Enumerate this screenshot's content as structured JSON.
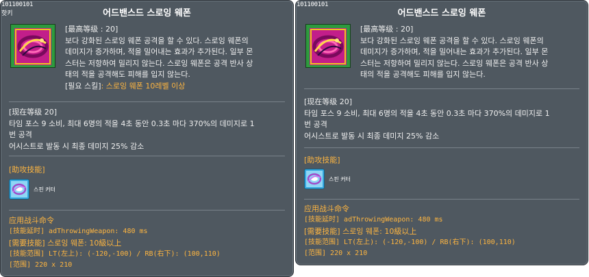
{
  "tooltips": [
    {
      "skill_id": "101100101",
      "hotkey": "핫키",
      "title": "어드밴스드 스로잉 웨폰",
      "icon": "throwing-weapon-skill-icon",
      "desc_lines": [
        "[最高等级 : 20]",
        "보다 강화된 스로잉 웨폰 공격을 할 수 있다. 스로잉 웨폰의",
        "데미지가 증가하며, 적을 밀어내는 효과가 추가된다. 일부 몬",
        "스터는 저항하여 밀리지 않는다. 스로잉 웨폰은 공격 반사 상",
        "태의 적을 공격해도 피해를 입지 않는다."
      ],
      "required_skill_label": "[필요 스킬]",
      "required_skill_value": ": 스로잉 웨폰 10레벨 이상",
      "current_level_lines": [
        "[现在等级 20]",
        "타임 포스 9 소비, 최대 6명의 적을 4초 동안 0.3초 마다 370%의 데미지로 1",
        "번 공격",
        "어시스트로 발동 시 최종 데미지 25% 감소"
      ],
      "assist_title": "[助攻技能]",
      "assist_skill_name": "스핀 커터",
      "assist_icon": "spin-cutter-skill-icon",
      "combat_lines": [
        "应用战斗命令",
        "[技能延时] adThrowingWeapon: 480 ms",
        "[需要技能] 스로잉 웨폰: 10級以上",
        "[技能范围] LT(左上): (-120,-100) / RB(右下): (100,110)",
        "[范围] 220 x 210"
      ]
    },
    {
      "skill_id": "101100101",
      "title": "어드밴스드 스로잉 웨폰",
      "icon": "throwing-weapon-skill-icon",
      "desc_lines": [
        "[最高等级 : 20]",
        "보다 강화된 스로잉 웨폰 공격을 할 수 있다. 스로잉 웨폰의",
        "데미지가 증가하며, 적을 밀어내는 효과가 추가된다. 일부 몬",
        "스터는 저항하여 밀리지 않는다. 스로잉 웨폰은 공격 반사 상",
        "태의 적을 공격해도 피해를 입지 않는다."
      ],
      "current_level_lines": [
        "[现在等级 20]",
        "타임 포스 9 소비, 최대 6명의 적을 4초 동안 0.3초 마다 370%의 데미지로 1",
        "번 공격",
        "어시스트로 발동 시 최종 데미지 25% 감소"
      ],
      "assist_title": "[助攻技能]",
      "assist_skill_name": "스핀 커터",
      "assist_icon": "spin-cutter-skill-icon",
      "combat_lines": [
        "应用战斗命令",
        "[技能延时] adThrowingWeapon: 480 ms",
        "[需要技能] 스로잉 웨폰: 10級以上",
        "[技能范围] LT(左上): (-120,-100) / RB(右下): (100,110)",
        "[范围] 220 x 210"
      ]
    }
  ],
  "colors": {
    "panel_bg": "#4f5860",
    "text": "#f0f0f0",
    "accent_orange": "#ffb640",
    "icon_frame_green": "#2e9a3e",
    "assist_icon_blue": "#35a8e0"
  }
}
